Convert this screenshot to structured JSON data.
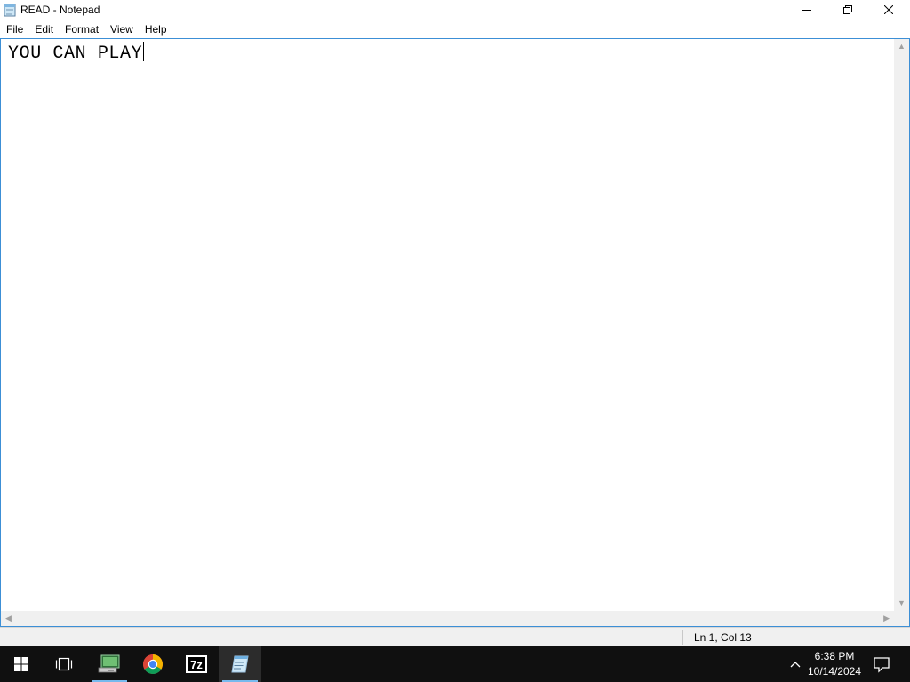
{
  "window": {
    "title": "READ - Notepad",
    "app_icon": "notepad-icon"
  },
  "menu": {
    "items": [
      "File",
      "Edit",
      "Format",
      "View",
      "Help"
    ]
  },
  "editor": {
    "content": "YOU CAN PLAY"
  },
  "statusbar": {
    "position": "Ln 1, Col 13"
  },
  "taskbar": {
    "items": [
      "start-icon",
      "task-view-icon",
      "computer-icon",
      "chrome-icon",
      "7zip-icon",
      "notepad-icon"
    ],
    "active_item": "notepad-icon",
    "sevenzip_label": "7z",
    "time": "6:38 PM",
    "date": "10/14/2024"
  },
  "colors": {
    "accent": "#3c8fd6",
    "taskbar": "#101010",
    "active_indicator": "#76b9ed"
  }
}
